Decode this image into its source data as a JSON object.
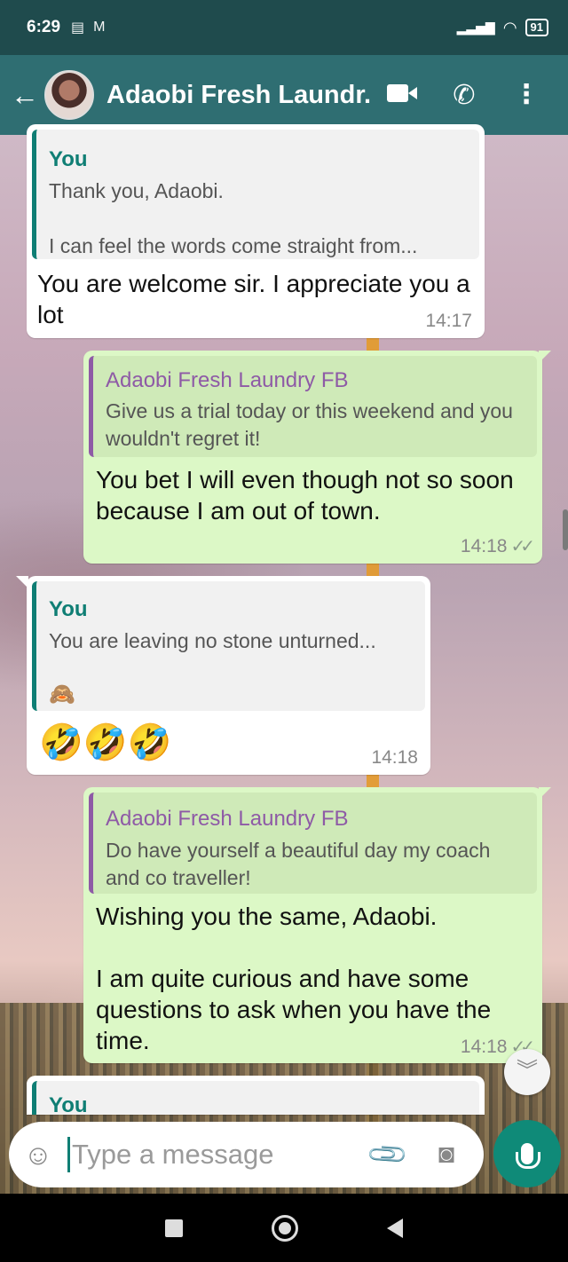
{
  "status_bar": {
    "time": "6:29",
    "battery": "91"
  },
  "header": {
    "contact_name": "Adaobi Fresh Laundr..."
  },
  "messages": [
    {
      "direction": "incoming",
      "quote_author": "You",
      "quote_text": "Thank you, Adaobi.\n\nI can feel the words come straight from...",
      "text": "You are welcome sir. I appreciate you a lot",
      "time": "14:17"
    },
    {
      "direction": "outgoing",
      "quote_author": "Adaobi Fresh Laundry FB",
      "quote_text": "Give us a trial today or this weekend and you wouldn't regret it!",
      "text": "You bet I will even though not so soon because I am out of town.",
      "time": "14:18"
    },
    {
      "direction": "incoming",
      "quote_author": "You",
      "quote_text": "You are leaving no stone unturned...",
      "quote_emoji": "🙈",
      "text": "🤣🤣🤣",
      "time": "14:18"
    },
    {
      "direction": "outgoing",
      "quote_author": "Adaobi Fresh Laundry FB",
      "quote_text": "Do have yourself a beautiful day my coach and co traveller!",
      "text": "Wishing you the same, Adaobi.\n\nI am quite curious and have some questions to ask when you have the time.",
      "time": "14:18"
    },
    {
      "direction": "incoming",
      "quote_author": "You"
    }
  ],
  "composer": {
    "placeholder": "Type a message"
  },
  "icons": {
    "back": "arrow-left-icon",
    "video": "video-call-icon",
    "phone": "phone-call-icon",
    "menu": "more-vert-icon",
    "emoji": "emoji-icon",
    "attach": "paperclip-icon",
    "camera": "camera-icon",
    "mic": "mic-icon",
    "scroll_down": "chevron-double-down-icon"
  },
  "colors": {
    "header": "#2f6e72",
    "status_bar": "#1f4b4d",
    "outgoing_bubble": "#dcf8c6",
    "incoming_bubble": "#ffffff",
    "accent": "#0f8a78"
  }
}
